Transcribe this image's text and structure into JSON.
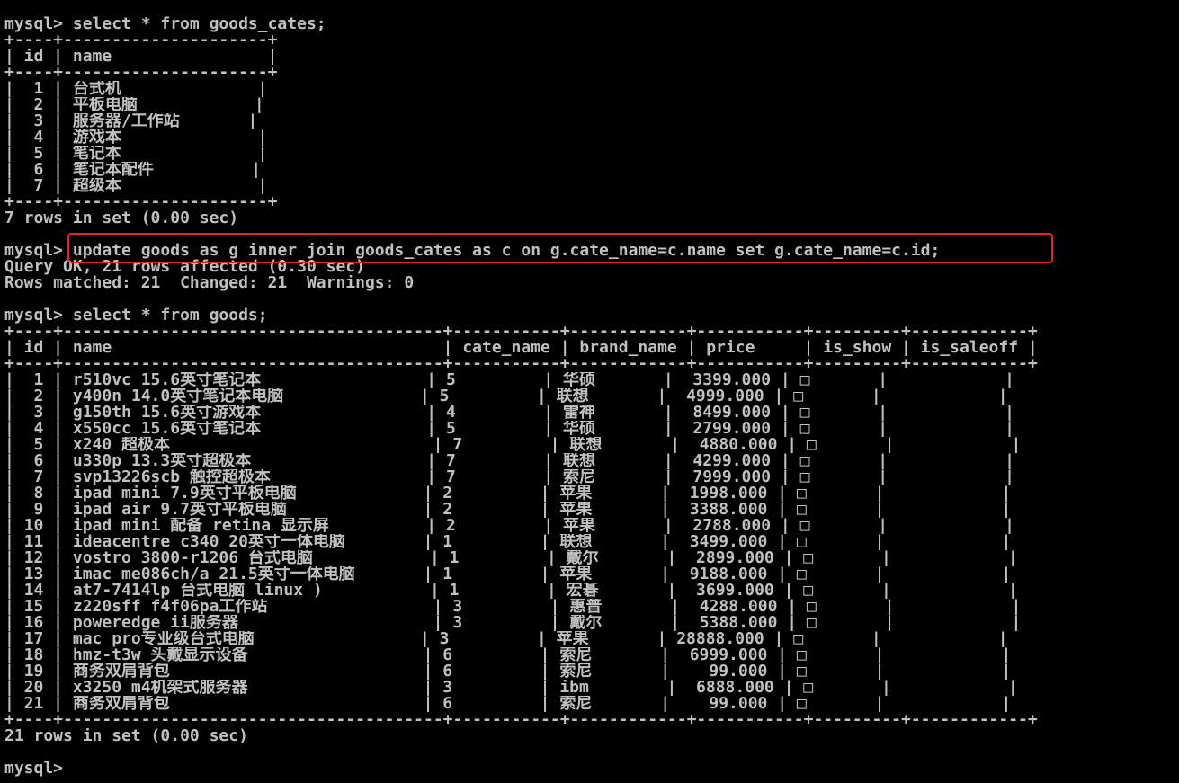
{
  "colors": {
    "background": "#000000",
    "text": "#c0c0c0",
    "highlight_box": "#e3261f"
  },
  "lines": [
    "mysql> select * from goods_cates;",
    "+----+---------------------+",
    "| id | name                |",
    "+----+---------------------+",
    "|  1 | 台式机              |",
    "|  2 | 平板电脑            |",
    "|  3 | 服务器/工作站       |",
    "|  4 | 游戏本              |",
    "|  5 | 笔记本              |",
    "|  6 | 笔记本配件          |",
    "|  7 | 超级本              |",
    "+----+---------------------+",
    "7 rows in set (0.00 sec)",
    "",
    "mysql> update goods as g inner join goods_cates as c on g.cate_name=c.name set g.cate_name=c.id;",
    "Query OK, 21 rows affected (0.30 sec)",
    "Rows matched: 21  Changed: 21  Warnings: 0",
    "",
    "mysql> select * from goods;",
    "+----+---------------------------------------+-----------+------------+-----------+---------+------------+",
    "| id | name                                  | cate_name | brand_name | price     | is_show | is_saleoff |",
    "+----+---------------------------------------+-----------+------------+-----------+---------+------------+",
    "|  1 | r510vc 15.6英寸笔记本                 | 5         | 华硕       |  3399.000 | □       |            |",
    "|  2 | y400n 14.0英寸笔记本电脑              | 5         | 联想       |  4999.000 | □       |            |",
    "|  3 | g150th 15.6英寸游戏本                 | 4         | 雷神       |  8499.000 | □       |            |",
    "|  4 | x550cc 15.6英寸笔记本                 | 5         | 华硕       |  2799.000 | □       |            |",
    "|  5 | x240 超极本                           | 7         | 联想       |  4880.000 | □       |            |",
    "|  6 | u330p 13.3英寸超极本                  | 7         | 联想       |  4299.000 | □       |            |",
    "|  7 | svp13226scb 触控超极本                | 7         | 索尼       |  7999.000 | □       |            |",
    "|  8 | ipad mini 7.9英寸平板电脑             | 2         | 苹果       |  1998.000 | □       |            |",
    "|  9 | ipad air 9.7英寸平板电脑              | 2         | 苹果       |  3388.000 | □       |            |",
    "| 10 | ipad mini 配备 retina 显示屏          | 2         | 苹果       |  2788.000 | □       |            |",
    "| 11 | ideacentre c340 20英寸一体电脑        | 1         | 联想       |  3499.000 | □       |            |",
    "| 12 | vostro 3800-r1206 台式电脑            | 1         | 戴尔       |  2899.000 | □       |            |",
    "| 13 | imac me086ch/a 21.5英寸一体电脑       | 1         | 苹果       |  9188.000 | □       |            |",
    "| 14 | at7-7414lp 台式电脑 linux )           | 1         | 宏碁       |  3699.000 | □       |            |",
    "| 15 | z220sff f4f06pa工作站                 | 3         | 惠普       |  4288.000 | □       |            |",
    "| 16 | poweredge ii服务器                    | 3         | 戴尔       |  5388.000 | □       |            |",
    "| 17 | mac pro专业级台式电脑                 | 3         | 苹果       | 28888.000 | □       |            |",
    "| 18 | hmz-t3w 头戴显示设备                  | 6         | 索尼       |  6999.000 | □       |            |",
    "| 19 | 商务双肩背包                          | 6         | 索尼       |    99.000 | □       |            |",
    "| 20 | x3250 m4机架式服务器                  | 3         | ibm        |  6888.000 | □       |            |",
    "| 21 | 商务双肩背包                          | 6         | 索尼       |    99.000 | □       |            |",
    "+----+---------------------------------------+-----------+------------+-----------+---------+------------+",
    "21 rows in set (0.00 sec)",
    "",
    "mysql> "
  ]
}
